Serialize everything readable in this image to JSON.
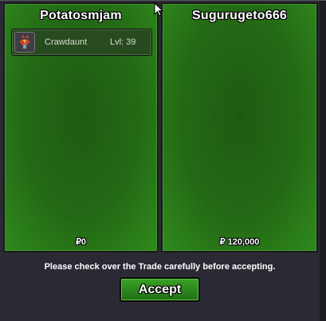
{
  "left_panel": {
    "player_name": "Potatosmjam",
    "pokemon": [
      {
        "name": "Crawdaunt",
        "level_text": "Lvl: 39",
        "sprite_icon": "crawdaunt-sprite-icon"
      }
    ],
    "money": "₽0"
  },
  "right_panel": {
    "player_name": "Sugurugeto666",
    "pokemon": [],
    "money": "₽ 120,000"
  },
  "notice": "Please check over the Trade carefully before accepting.",
  "accept_label": "Accept",
  "colors": {
    "panel_green": "#246a15",
    "button_green": "#2f8a1d",
    "background": "#2b2a34"
  }
}
